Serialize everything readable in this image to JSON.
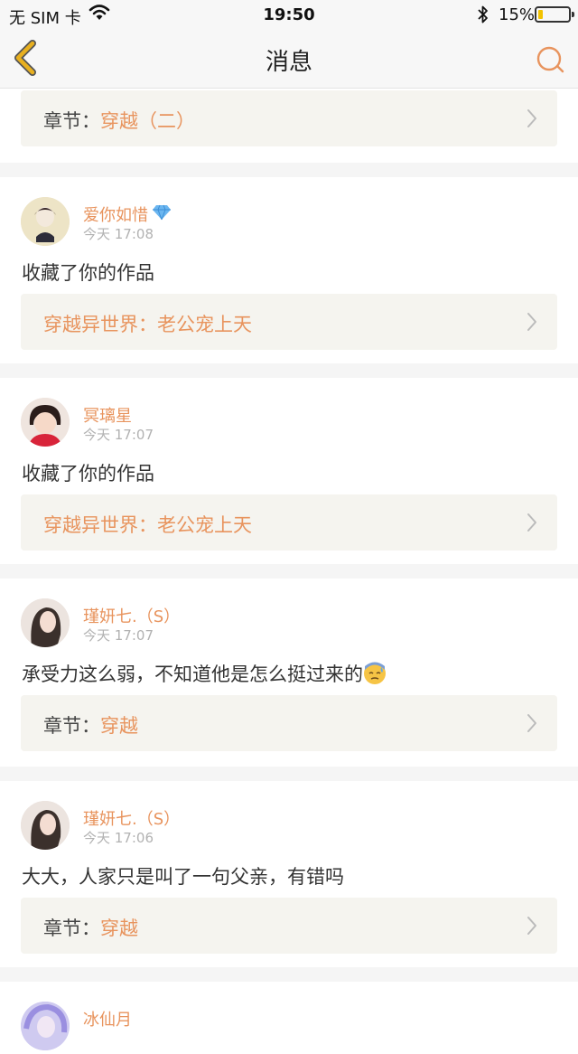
{
  "status_bar": {
    "carrier": "无 SIM 卡",
    "time": "19:50",
    "battery": "15%",
    "battery_level": 0.15
  },
  "nav": {
    "title": "消息",
    "back_icon": "chevron-left-icon",
    "search_icon": "search-icon"
  },
  "top_partial_card": {
    "label": "章节：",
    "value": "穿越（二）"
  },
  "messages": [
    {
      "user": "爱你如惜",
      "badge": "diamond-icon",
      "time": "今天 17:08",
      "text": "收藏了你的作品",
      "ref_label": "",
      "ref_value": "穿越异世界：老公宠上天"
    },
    {
      "user": "冥璃星",
      "time": "今天 17:07",
      "text": "收藏了你的作品",
      "ref_label": "",
      "ref_value": "穿越异世界：老公宠上天"
    },
    {
      "user": "瑾妍七.（S）",
      "time": "今天 17:07",
      "text": "承受力这么弱，不知道他是怎么挺过来的",
      "emoji": "sad-sweat-emoji",
      "ref_label": "章节：",
      "ref_value": "穿越"
    },
    {
      "user": "瑾妍七.（S）",
      "time": "今天 17:06",
      "text": "大大，人家只是叫了一句父亲，有错吗",
      "ref_label": "章节：",
      "ref_value": "穿越"
    },
    {
      "user": "冰仙月"
    }
  ],
  "colors": {
    "accent": "#e8945e",
    "card_bg": "#f5f4ef",
    "separator": "#f5f5f5",
    "back_icon": "#e8b020"
  }
}
